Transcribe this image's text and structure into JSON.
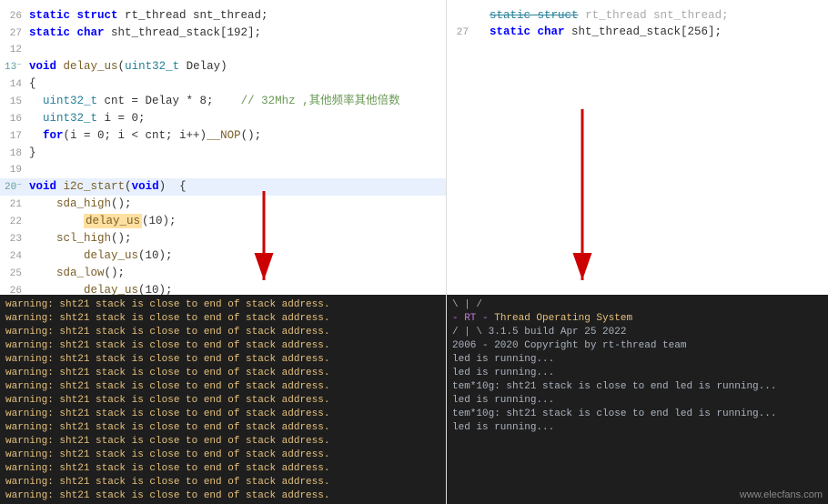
{
  "left_code": {
    "lines": [
      {
        "num": "26",
        "content": "  static struct rt_thread snt_thread;"
      },
      {
        "num": "27",
        "content": "  static char sht_thread_stack[192];"
      },
      {
        "num": "12",
        "content": ""
      },
      {
        "num": "13",
        "content": "void delay_us(uint32_t Delay)"
      },
      {
        "num": "14",
        "content": "{"
      },
      {
        "num": "15",
        "content": "  uint32_t cnt = Delay * 8;    // 32Mhz ,其他频率其他倍数"
      },
      {
        "num": "16",
        "content": "  uint32_t i = 0;"
      },
      {
        "num": "17",
        "content": "  for(i = 0; i < cnt; i++)__NOP();"
      },
      {
        "num": "18",
        "content": "}"
      },
      {
        "num": "19",
        "content": ""
      },
      {
        "num": "20",
        "content": "void i2c_start(void)  {"
      },
      {
        "num": "21",
        "content": "    sda_high();"
      },
      {
        "num": "22",
        "content": "        delay_us(10);"
      },
      {
        "num": "23",
        "content": "    scl_high();"
      },
      {
        "num": "24",
        "content": "        delay_us(10);"
      },
      {
        "num": "25",
        "content": "    sda_low();"
      },
      {
        "num": "26",
        "content": "        delay_us(10);"
      }
    ]
  },
  "right_code": {
    "lines": [
      {
        "num": "27",
        "content": "  static char sht_thread_stack[256];"
      }
    ]
  },
  "left_terminal": {
    "lines": [
      "warning: sht21 stack is close to end of stack address.",
      "warning: sht21 stack is close to end of stack address.",
      "warning: sht21 stack is close to end of stack address.",
      "warning: sht21 stack is close to end of stack address.",
      "warning: sht21 stack is close to end of stack address.",
      "warning: sht21 stack is close to end of stack address.",
      "warning: sht21 stack is close to end of stack address.",
      "warning: sht21 stack is close to end of stack address.",
      "warning: sht21 stack is close to end of stack address.",
      "warning: sht21 stack is close to end of stack address.",
      "warning: sht21 stack is close to end of stack address.",
      "warning: sht21 stack is close to end of stack address.",
      "warning: sht21 stack is close to end of stack address.",
      "warning: sht21 stack is close to end of stack address.",
      "warning: sht21 stack is close to end of stack address."
    ]
  },
  "right_terminal": {
    "ascii_art": [
      "  \\ | /",
      "- RT -    Thread Operating System",
      "  / | \\    3.1.5 build Apr 25 2022",
      " 2006 - 2020 Copyright by rt-thread team"
    ],
    "lines": [
      "led is running...",
      "led is running...",
      "tem*10g: sht21 stack is close to end led is running...",
      "led is running...",
      "tem*10g: sht21 stack is close to end led is running...",
      "led is running..."
    ]
  },
  "watermark": "www.elecfans.com"
}
